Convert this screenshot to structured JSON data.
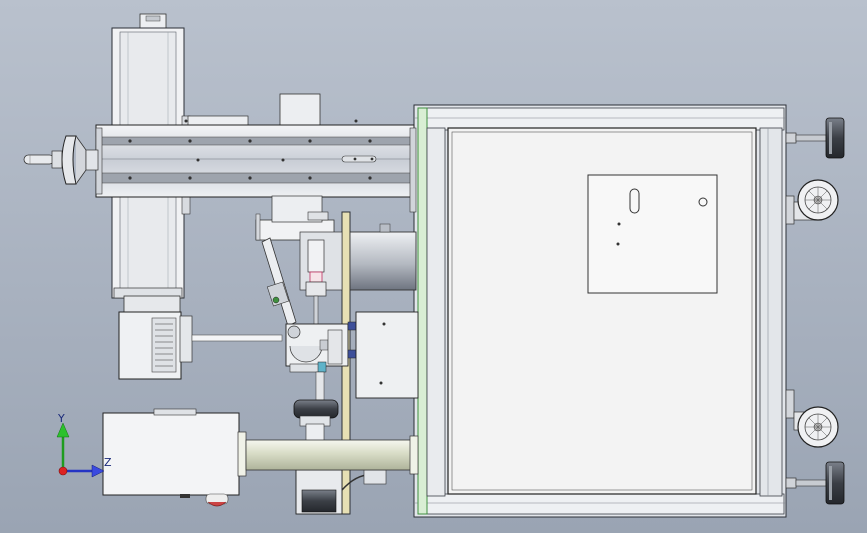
{
  "triad": {
    "y_label": "Y",
    "z_label": "Z",
    "y_color": "#22aa22",
    "z_color": "#2233cc",
    "origin_color": "#dd2222"
  },
  "scene": {
    "background_color": "#a8b1bf",
    "frame_color": "#e6e8ec",
    "panel_color": "#f3f3f3",
    "accent_color": "#3f8f3f"
  }
}
